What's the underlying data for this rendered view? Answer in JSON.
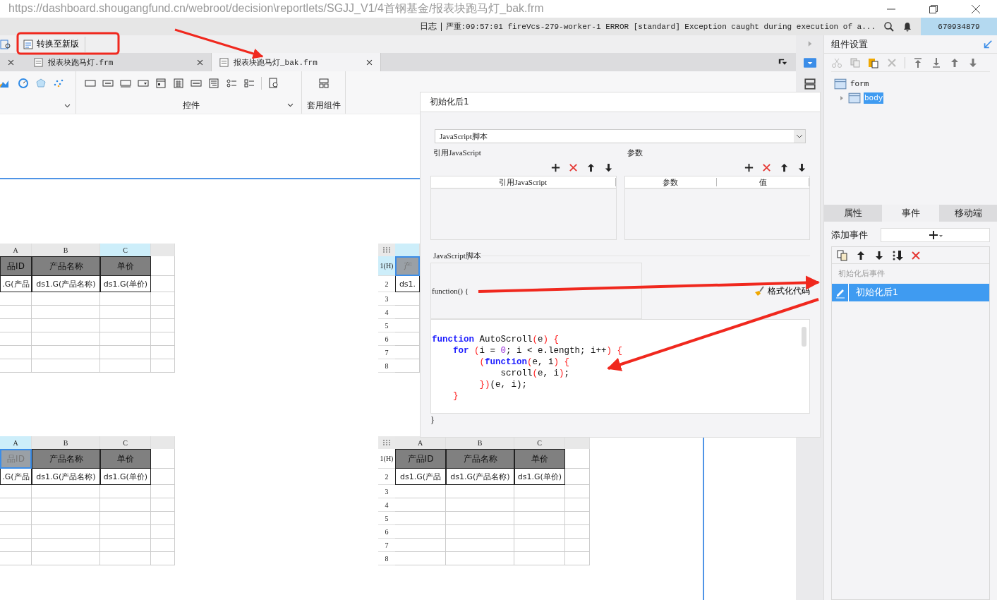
{
  "url": "https://dashboard.shougangfund.cn/webroot/decision\\reportlets/SGJJ_V1/4首钢基金/报表块跑马灯_bak.frm",
  "status": {
    "log_label": "日志",
    "log_text": "严重:09:57:01 fireVcs-279-worker-1 ERROR [standard] Exception caught during execution of a...",
    "user": "670934879"
  },
  "toolbar": {
    "convert_button": "转换至新版"
  },
  "tabs": [
    {
      "label": "报表块跑马灯.frm",
      "selected": false
    },
    {
      "label": "报表块跑马灯_bak.frm",
      "selected": true
    }
  ],
  "ribbon": {
    "groups": [
      {
        "label": "控件"
      },
      {
        "label": "套用组件"
      }
    ]
  },
  "sheets": [
    {
      "kind": "clipped",
      "columns": [
        {
          "label": "A",
          "selected": false
        },
        {
          "label": "B",
          "selected": false
        },
        {
          "label": "C",
          "selected": true
        }
      ],
      "header": [
        {
          "text": "品ID",
          "selected": false
        },
        {
          "text": "产品名称",
          "selected": false
        },
        {
          "text": "单价",
          "selected": false
        }
      ],
      "data": [
        ".G(产品",
        "ds1.G(产品名称)",
        "ds1.G(单价)"
      ]
    },
    {
      "kind": "covered",
      "row_numbers": [
        "1(H)",
        "2",
        "3",
        "4",
        "5",
        "6",
        "7",
        "8"
      ],
      "columns": [
        {
          "selected": true
        }
      ],
      "header": [
        {
          "text": "产",
          "selected": true
        }
      ],
      "data": [
        "ds1."
      ]
    },
    {
      "kind": "clipped",
      "columns": [
        {
          "label": "A",
          "selected": true
        },
        {
          "label": "B",
          "selected": false
        },
        {
          "label": "C",
          "selected": false
        }
      ],
      "header": [
        {
          "text": "品ID",
          "selected": true
        },
        {
          "text": "产品名称",
          "selected": false
        },
        {
          "text": "单价",
          "selected": false
        }
      ],
      "data": [
        ".G(产品",
        "ds1.G(产品名称)",
        "ds1.G(单价)"
      ]
    },
    {
      "kind": "full",
      "row_numbers": [
        "1(H)",
        "2",
        "3",
        "4",
        "5",
        "6",
        "7",
        "8"
      ],
      "columns": [
        {
          "label": "A",
          "selected": false
        },
        {
          "label": "B",
          "selected": false
        },
        {
          "label": "C",
          "selected": false
        }
      ],
      "header": [
        {
          "text": "产品ID",
          "selected": false
        },
        {
          "text": "产品名称",
          "selected": false
        },
        {
          "text": "单价",
          "selected": false
        }
      ],
      "data": [
        "ds1.G(产品",
        "ds1.G(产品名称)",
        "ds1.G(单价)"
      ]
    }
  ],
  "dialog": {
    "title": "初始化后1",
    "script_type": "JavaScript脚本",
    "ref_section": {
      "label": "引用JavaScript",
      "columns": [
        "引用JavaScript"
      ]
    },
    "param_section": {
      "label": "参数",
      "columns": [
        "参数",
        "值"
      ]
    },
    "script_section": {
      "label": "JavaScript脚本",
      "header": "function() {",
      "format_button": "格式化代码",
      "footer": "}",
      "code": [
        [
          {
            "kind": "keyword",
            "text": "function"
          },
          {
            "kind": "plain",
            "text": " AutoScroll"
          },
          {
            "kind": "bracket",
            "text": "("
          },
          {
            "kind": "plain",
            "text": "e"
          },
          {
            "kind": "bracket",
            "text": ") {"
          }
        ],
        [
          {
            "kind": "keyword",
            "text": "    for"
          },
          {
            "kind": "bracket",
            "text": " ("
          },
          {
            "kind": "plain",
            "text": "i = "
          },
          {
            "kind": "number",
            "text": "0"
          },
          {
            "kind": "plain",
            "text": "; i < e.length; i++"
          },
          {
            "kind": "bracket",
            "text": ") {"
          }
        ],
        [
          {
            "kind": "bracket",
            "text": "         ("
          },
          {
            "kind": "keyword",
            "text": "function"
          },
          {
            "kind": "bracket",
            "text": "("
          },
          {
            "kind": "plain",
            "text": "e, i"
          },
          {
            "kind": "bracket",
            "text": ") {"
          }
        ],
        [
          {
            "kind": "plain",
            "text": "             scroll"
          },
          {
            "kind": "bracket",
            "text": "("
          },
          {
            "kind": "plain",
            "text": "e, i"
          },
          {
            "kind": "bracket",
            "text": ")"
          },
          {
            "kind": "plain",
            "text": ";"
          }
        ],
        [
          {
            "kind": "bracket",
            "text": "         })"
          },
          {
            "kind": "plain",
            "text": "(e, i);"
          }
        ],
        [
          {
            "kind": "bracket",
            "text": "    }"
          }
        ]
      ]
    }
  },
  "panel": {
    "title": "组件设置",
    "tree": [
      {
        "label": "form",
        "selected": false,
        "children": [
          {
            "label": "body",
            "expanded": false,
            "selected": true
          }
        ]
      }
    ],
    "tabs": [
      {
        "label": "属性",
        "selected": false
      },
      {
        "label": "事件",
        "selected": true
      },
      {
        "label": "移动端",
        "selected": false
      }
    ],
    "add_label": "添加事件",
    "event_groups": [
      {
        "label": "初始化后事件",
        "items": [
          {
            "label": "初始化后1",
            "selected": true
          }
        ]
      }
    ]
  }
}
